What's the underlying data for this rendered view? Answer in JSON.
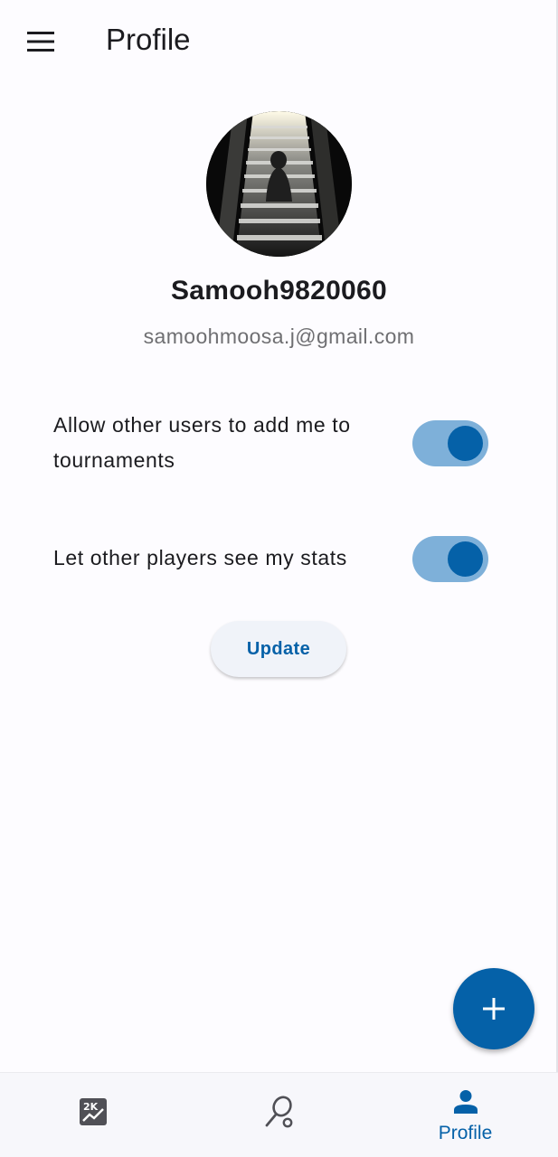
{
  "app_bar": {
    "title": "Profile",
    "menu_icon": "hamburger-menu-icon"
  },
  "profile": {
    "username": "Samooh9820060",
    "email": "samoohmoosa.j@gmail.com"
  },
  "settings": [
    {
      "label": "Allow other users to add me to tournaments",
      "enabled": true
    },
    {
      "label": "Let other players see my stats",
      "enabled": true
    }
  ],
  "update_button": {
    "label": "Update"
  },
  "fab": {
    "icon": "plus-icon"
  },
  "bottom_nav": {
    "items": [
      {
        "icon": "stats-chart-icon",
        "label": ""
      },
      {
        "icon": "racket-icon",
        "label": ""
      },
      {
        "icon": "person-icon",
        "label": "Profile",
        "active": true
      }
    ]
  },
  "colors": {
    "primary": "#0561a8",
    "toggle_track": "#7eb0d9",
    "background": "#fdfcff",
    "secondary_text": "#6f6f72"
  }
}
